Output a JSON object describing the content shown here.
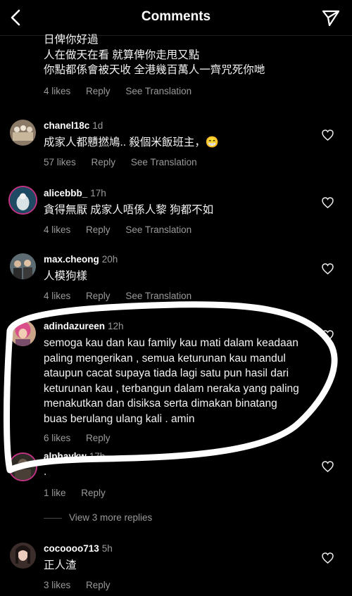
{
  "header": {
    "title": "Comments",
    "back_icon": "chevron-left-icon",
    "send_icon": "paper-plane-icon"
  },
  "colors": {
    "background": "#000000",
    "text": "#f5f5f5",
    "muted": "#9a9a9a",
    "annotation": "#ffffff"
  },
  "partial_comment": {
    "lines": [
      "日俾你好過",
      "人在做天在看 就算俾你走甩又點",
      "你點都係會被天收 全港幾百萬人一齊咒死你哋"
    ],
    "likes": "4 likes",
    "reply": "Reply",
    "translate": "See Translation"
  },
  "comments": [
    {
      "username": "chanel18c",
      "time": "1d",
      "text": "成家人都戇撚鳩.. 殺個米飯班主，😁",
      "likes": "57 likes",
      "reply": "Reply",
      "translate": "See Translation"
    },
    {
      "username": "alicebbb_",
      "time": "17h",
      "text": "貪得無厭 成家人唔係人黎 狗都不如",
      "likes": "4 likes",
      "reply": "Reply",
      "translate": "See Translation"
    },
    {
      "username": "max.cheong",
      "time": "20h",
      "text": "人模狗樣",
      "likes": "4 likes",
      "reply": "Reply",
      "translate": "See Translation"
    },
    {
      "username": "adindazureen",
      "time": "12h",
      "text": "semoga kau dan kau family kau mati dalam keadaan paling mengerikan , semua keturunan kau mandul ataupun cacat supaya tiada lagi satu pun hasil dari keturunan kau , terbangun dalam neraka yang paling menakutkan dan disiksa serta dimakan binatang buas berulang ulang kali . amin",
      "likes": "6 likes",
      "reply": "Reply"
    },
    {
      "username": "alphaykw",
      "time": "17h",
      "text": ".",
      "likes": "1 like",
      "reply": "Reply"
    },
    {
      "username": "cocoooo713",
      "time": "5h",
      "text": "正人渣",
      "likes": "3 likes",
      "reply": "Reply"
    }
  ],
  "view_more": "View 3 more replies"
}
